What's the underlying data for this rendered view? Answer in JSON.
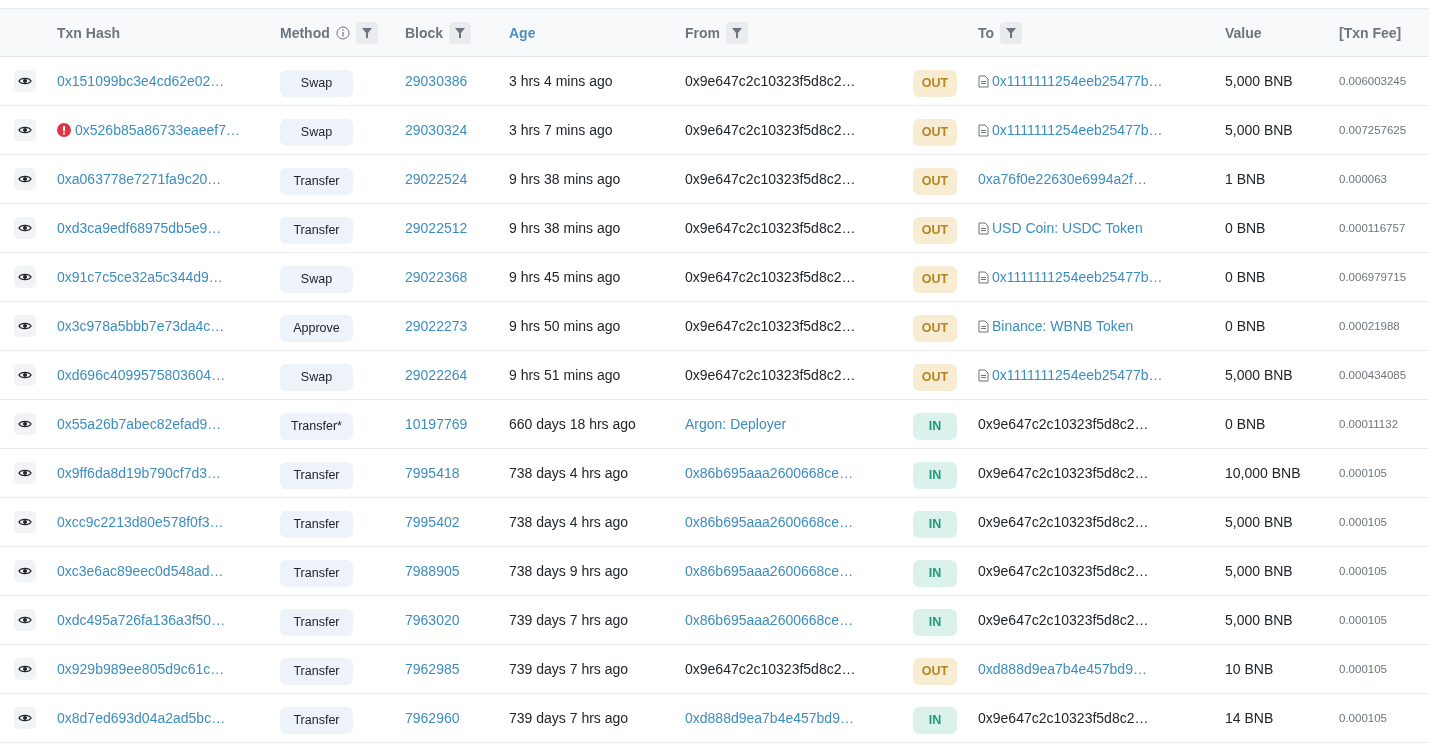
{
  "table": {
    "columns": [
      {
        "label": "Txn Hash",
        "info": false,
        "filter": false,
        "selected": false
      },
      {
        "label": "Method",
        "info": true,
        "filter": true,
        "selected": false
      },
      {
        "label": "Block",
        "info": false,
        "filter": true,
        "selected": false
      },
      {
        "label": "Age",
        "info": false,
        "filter": false,
        "selected": true
      },
      {
        "label": "From",
        "info": false,
        "filter": true,
        "selected": false
      },
      {
        "label": "To",
        "info": false,
        "filter": true,
        "selected": false
      },
      {
        "label": "Value",
        "info": false,
        "filter": false,
        "selected": false
      },
      {
        "label": "[Txn Fee]",
        "info": false,
        "filter": false,
        "selected": false
      }
    ],
    "rows": [
      {
        "hash": "0x151099bc3e4cd62e02…",
        "error": false,
        "method": "Swap",
        "block": "29030386",
        "age": "3 hrs 4 mins ago",
        "from": "0x9e647c2c10323f5d8c2…",
        "from_link": false,
        "direction": "OUT",
        "to": "0x1111111254eeb25477b…",
        "to_link": true,
        "contract": true,
        "value": "5,000 BNB",
        "fee": "0.006003245"
      },
      {
        "hash": "0x526b85a86733eaeef7…",
        "error": true,
        "method": "Swap",
        "block": "29030324",
        "age": "3 hrs 7 mins ago",
        "from": "0x9e647c2c10323f5d8c2…",
        "from_link": false,
        "direction": "OUT",
        "to": "0x1111111254eeb25477b…",
        "to_link": true,
        "contract": true,
        "value": "5,000 BNB",
        "fee": "0.007257625"
      },
      {
        "hash": "0xa063778e7271fa9c20…",
        "error": false,
        "method": "Transfer",
        "block": "29022524",
        "age": "9 hrs 38 mins ago",
        "from": "0x9e647c2c10323f5d8c2…",
        "from_link": false,
        "direction": "OUT",
        "to": "0xa76f0e22630e6994a2f…",
        "to_link": true,
        "contract": false,
        "value": "1 BNB",
        "fee": "0.000063"
      },
      {
        "hash": "0xd3ca9edf68975db5e9…",
        "error": false,
        "method": "Transfer",
        "block": "29022512",
        "age": "9 hrs 38 mins ago",
        "from": "0x9e647c2c10323f5d8c2…",
        "from_link": false,
        "direction": "OUT",
        "to": "USD Coin: USDC Token",
        "to_link": true,
        "contract": true,
        "value": "0 BNB",
        "fee": "0.000116757"
      },
      {
        "hash": "0x91c7c5ce32a5c344d9…",
        "error": false,
        "method": "Swap",
        "block": "29022368",
        "age": "9 hrs 45 mins ago",
        "from": "0x9e647c2c10323f5d8c2…",
        "from_link": false,
        "direction": "OUT",
        "to": "0x1111111254eeb25477b…",
        "to_link": true,
        "contract": true,
        "value": "0 BNB",
        "fee": "0.006979715"
      },
      {
        "hash": "0x3c978a5bbb7e73da4c…",
        "error": false,
        "method": "Approve",
        "block": "29022273",
        "age": "9 hrs 50 mins ago",
        "from": "0x9e647c2c10323f5d8c2…",
        "from_link": false,
        "direction": "OUT",
        "to": "Binance: WBNB Token",
        "to_link": true,
        "contract": true,
        "value": "0 BNB",
        "fee": "0.00021988"
      },
      {
        "hash": "0xd696c4099575803604…",
        "error": false,
        "method": "Swap",
        "block": "29022264",
        "age": "9 hrs 51 mins ago",
        "from": "0x9e647c2c10323f5d8c2…",
        "from_link": false,
        "direction": "OUT",
        "to": "0x1111111254eeb25477b…",
        "to_link": true,
        "contract": true,
        "value": "5,000 BNB",
        "fee": "0.000434085"
      },
      {
        "hash": "0x55a26b7abec82efad9…",
        "error": false,
        "method": "Transfer*",
        "block": "10197769",
        "age": "660 days 18 hrs ago",
        "from": "Argon: Deployer",
        "from_link": true,
        "direction": "IN",
        "to": "0x9e647c2c10323f5d8c2…",
        "to_link": false,
        "contract": false,
        "value": "0 BNB",
        "fee": "0.00011132"
      },
      {
        "hash": "0x9ff6da8d19b790cf7d3…",
        "error": false,
        "method": "Transfer",
        "block": "7995418",
        "age": "738 days 4 hrs ago",
        "from": "0x86b695aaa2600668ce…",
        "from_link": true,
        "direction": "IN",
        "to": "0x9e647c2c10323f5d8c2…",
        "to_link": false,
        "contract": false,
        "value": "10,000 BNB",
        "fee": "0.000105"
      },
      {
        "hash": "0xcc9c2213d80e578f0f3…",
        "error": false,
        "method": "Transfer",
        "block": "7995402",
        "age": "738 days 4 hrs ago",
        "from": "0x86b695aaa2600668ce…",
        "from_link": true,
        "direction": "IN",
        "to": "0x9e647c2c10323f5d8c2…",
        "to_link": false,
        "contract": false,
        "value": "5,000 BNB",
        "fee": "0.000105"
      },
      {
        "hash": "0xc3e6ac89eec0d548ad…",
        "error": false,
        "method": "Transfer",
        "block": "7988905",
        "age": "738 days 9 hrs ago",
        "from": "0x86b695aaa2600668ce…",
        "from_link": true,
        "direction": "IN",
        "to": "0x9e647c2c10323f5d8c2…",
        "to_link": false,
        "contract": false,
        "value": "5,000 BNB",
        "fee": "0.000105"
      },
      {
        "hash": "0xdc495a726fa136a3f50…",
        "error": false,
        "method": "Transfer",
        "block": "7963020",
        "age": "739 days 7 hrs ago",
        "from": "0x86b695aaa2600668ce…",
        "from_link": true,
        "direction": "IN",
        "to": "0x9e647c2c10323f5d8c2…",
        "to_link": false,
        "contract": false,
        "value": "5,000 BNB",
        "fee": "0.000105"
      },
      {
        "hash": "0x929b989ee805d9c61c…",
        "error": false,
        "method": "Transfer",
        "block": "7962985",
        "age": "739 days 7 hrs ago",
        "from": "0x9e647c2c10323f5d8c2…",
        "from_link": false,
        "direction": "OUT",
        "to": "0xd888d9ea7b4e457bd9…",
        "to_link": true,
        "contract": false,
        "value": "10 BNB",
        "fee": "0.000105"
      },
      {
        "hash": "0x8d7ed693d04a2ad5bc…",
        "error": false,
        "method": "Transfer",
        "block": "7962960",
        "age": "739 days 7 hrs ago",
        "from": "0xd888d9ea7b4e457bd9…",
        "from_link": true,
        "direction": "IN",
        "to": "0x9e647c2c10323f5d8c2…",
        "to_link": false,
        "contract": false,
        "value": "14 BNB",
        "fee": "0.000105"
      }
    ]
  }
}
